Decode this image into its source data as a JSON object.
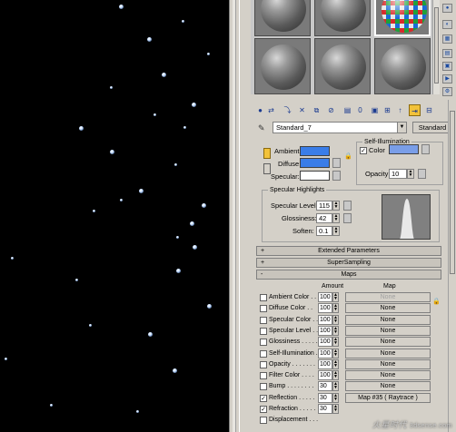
{
  "material": {
    "name": "Standard_7",
    "type": "Standard"
  },
  "blinn_basic": {
    "ambient_label": "Ambient:",
    "diffuse_label": "Diffuse:",
    "specular_label": "Specular:",
    "ambient_color": "#3a7de8",
    "diffuse_color": "#3a7de8",
    "specular_color": "#ffffff",
    "self_illum_title": "Self-Illumination",
    "color_label": "Color",
    "self_illum_color": "#7a9ee8",
    "opacity_label": "Opacity:",
    "opacity_value": "10"
  },
  "specular_highlights": {
    "title": "Specular Highlights",
    "level_label": "Specular Level:",
    "level_value": "115",
    "gloss_label": "Glossiness:",
    "gloss_value": "42",
    "soften_label": "Soften:",
    "soften_value": "0.1"
  },
  "rollouts": {
    "extended": "Extended Parameters",
    "supersampling": "SuperSampling",
    "maps": "Maps"
  },
  "maps": {
    "amount_header": "Amount",
    "map_header": "Map",
    "rows": [
      {
        "label": "Ambient Color . .",
        "amount": "100",
        "map": "None",
        "checked": false,
        "disabled": true
      },
      {
        "label": "Diffuse Color . .",
        "amount": "100",
        "map": "None",
        "checked": false,
        "disabled": false
      },
      {
        "label": "Specular Color . .",
        "amount": "100",
        "map": "None",
        "checked": false,
        "disabled": false
      },
      {
        "label": "Specular Level . .",
        "amount": "100",
        "map": "None",
        "checked": false,
        "disabled": false
      },
      {
        "label": "Glossiness . . . . .",
        "amount": "100",
        "map": "None",
        "checked": false,
        "disabled": false
      },
      {
        "label": "Self-Illumination .",
        "amount": "100",
        "map": "None",
        "checked": false,
        "disabled": false
      },
      {
        "label": "Opacity . . . . . . .",
        "amount": "100",
        "map": "None",
        "checked": false,
        "disabled": false
      },
      {
        "label": "Filter Color . . . .",
        "amount": "100",
        "map": "None",
        "checked": false,
        "disabled": false
      },
      {
        "label": "Bump . . . . . . . .",
        "amount": "30",
        "map": "None",
        "checked": false,
        "disabled": false
      },
      {
        "label": "Reflection . . . . .",
        "amount": "30",
        "map": "Map #35 ( Raytrace )",
        "checked": true,
        "disabled": false
      },
      {
        "label": "Refraction . . . . .",
        "amount": "30",
        "map": "",
        "checked": true,
        "disabled": false
      },
      {
        "label": "Displacement . . .",
        "amount": "",
        "map": "",
        "checked": false,
        "disabled": false
      }
    ]
  },
  "watermark": {
    "text": "火星时代",
    "url": "3dsense.com"
  }
}
